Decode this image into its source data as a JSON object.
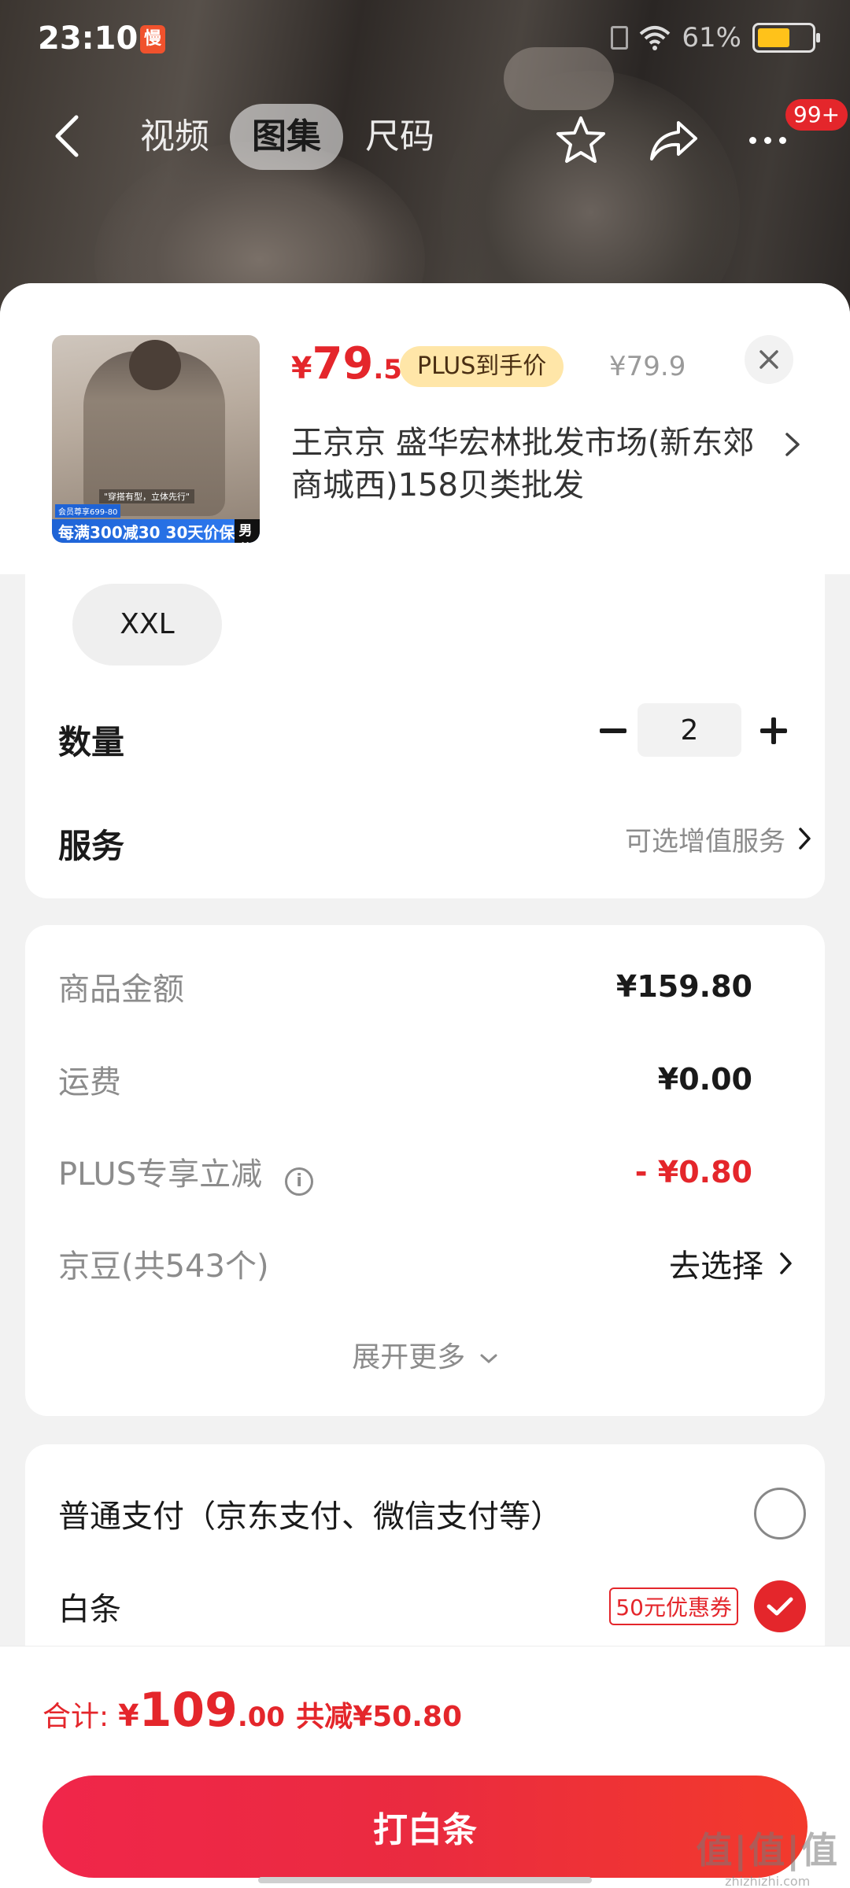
{
  "status_bar": {
    "time": "23:10",
    "app_badge": "慢",
    "battery_percent": "61%",
    "battery_level": 0.61
  },
  "nav": {
    "tabs": [
      {
        "label": "视频",
        "active": false
      },
      {
        "label": "图集",
        "active": true
      },
      {
        "label": "尺码",
        "active": false
      }
    ],
    "notification_badge": "99+"
  },
  "product": {
    "price_symbol": "¥",
    "price_int": "79",
    "price_dec": ".5",
    "plus_price_badge": "PLUS到手价",
    "original_price": "¥79.9",
    "shop_name": "王京京  盛华宏林批发市场(新东郊商城西)158贝类批发",
    "thumb_tagline": "\"穿搭有型，立体先行\"",
    "thumb_member_tag": "会员尊享699-80",
    "thumb_promo": "每满300减30  30天价保",
    "thumb_promo_tag": "男装节"
  },
  "spec": {
    "selected_size": "XXL",
    "quantity_label": "数量",
    "quantity_value": "2",
    "service_label": "服务",
    "service_hint": "可选增值服务"
  },
  "cost": {
    "goods_label": "商品金额",
    "goods_value": "¥159.80",
    "shipping_label": "运费",
    "shipping_value": "¥0.00",
    "plus_label": "PLUS专享立减",
    "plus_value": "- ¥0.80",
    "beans_label": "京豆(共543个)",
    "beans_action": "去选择",
    "expand_more": "展开更多"
  },
  "payment": {
    "normal_label": "普通支付（京东支付、微信支付等）",
    "normal_selected": false,
    "baitiao_label": "白条",
    "coupon_badge": "50元优惠券",
    "baitiao_selected": true
  },
  "footer": {
    "total_label": "合计:",
    "total_symbol": "¥",
    "total_int": "109",
    "total_dec": ".00",
    "total_saved": "共减¥50.80",
    "pay_button": "打白条"
  },
  "watermark": {
    "mark": "值|值|值",
    "url": "zhizhizhi.com"
  },
  "colors": {
    "accent": "#e4262b",
    "plus_badge_bg": "#ffe6a8",
    "battery": "#ffc21a"
  }
}
